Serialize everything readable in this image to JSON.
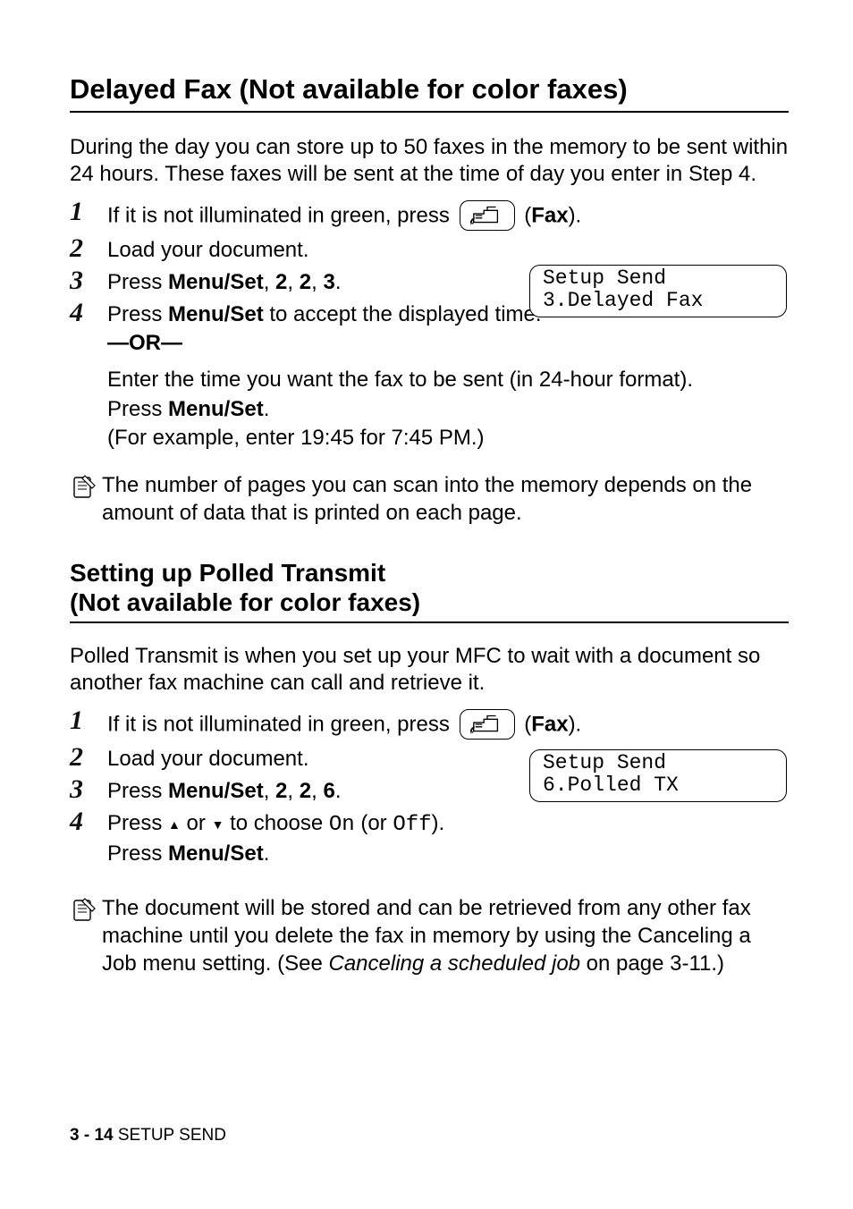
{
  "section1": {
    "heading": "Delayed Fax (Not available for color faxes)",
    "intro": "During the day you can store up to 50 faxes in the memory to be sent within 24 hours. These faxes will be sent at the time of day you enter in Step 4.",
    "steps": {
      "s1_pre": "If it is not illuminated in green, press ",
      "s1_post": " (",
      "s1_fax": "Fax",
      "s1_post2": ").",
      "s2": "Load your document.",
      "s3_pre": "Press ",
      "s3_b": "Menu/Set",
      "s3_post": ", ",
      "s3_n1": "2",
      "s3_n2": "2",
      "s3_n3": "3",
      "s3_post2": ".",
      "s4_pre": "Press ",
      "s4_b": "Menu/Set",
      "s4_post": " to accept the displayed time.",
      "s4_or": "—OR—",
      "s4_enter": "Enter the time you want the fax to be sent (in 24-hour format).",
      "s4_press_pre": "Press ",
      "s4_press_b": "Menu/Set",
      "s4_press_post": ".",
      "s4_example": "(For example, enter 19:45 for 7:45 PM.)"
    },
    "lcd": "Setup Send\n3.Delayed Fax",
    "note": "The number of pages you can scan into the memory depends on the amount of data that is printed on each page."
  },
  "section2": {
    "heading": "Setting up Polled Transmit\n(Not available for color faxes)",
    "intro": "Polled Transmit is when you set up your MFC to wait with a document so another fax machine can call and retrieve it.",
    "steps": {
      "s1_pre": "If it is not illuminated in green, press ",
      "s1_post": " (",
      "s1_fax": "Fax",
      "s1_post2": ").",
      "s2": "Load your document.",
      "s3_pre": "Press ",
      "s3_b": "Menu/Set",
      "s3_post": ", ",
      "s3_n1": "2",
      "s3_n2": "2",
      "s3_n3": "6",
      "s3_post2": ".",
      "s4_pre": "Press ",
      "s4_mid": " or ",
      "s4_post": " to choose ",
      "s4_on": "On",
      "s4_oroff_pre": " (or ",
      "s4_off": "Off",
      "s4_oroff_post": ").",
      "s4_press_pre": "Press ",
      "s4_press_b": "Menu/Set",
      "s4_press_post": "."
    },
    "lcd": "Setup Send\n6.Polled TX",
    "note_pre": "The document will be stored and can be retrieved from any other fax machine until you delete the fax in memory by using the Canceling a Job menu setting. (See ",
    "note_em": "Canceling a scheduled job",
    "note_post": " on page 3-11.)"
  },
  "footer": {
    "page": "3 - 14",
    "section": "   SETUP SEND"
  },
  "nums": {
    "n1": "1",
    "n2": "2",
    "n3": "3",
    "n4": "4"
  }
}
